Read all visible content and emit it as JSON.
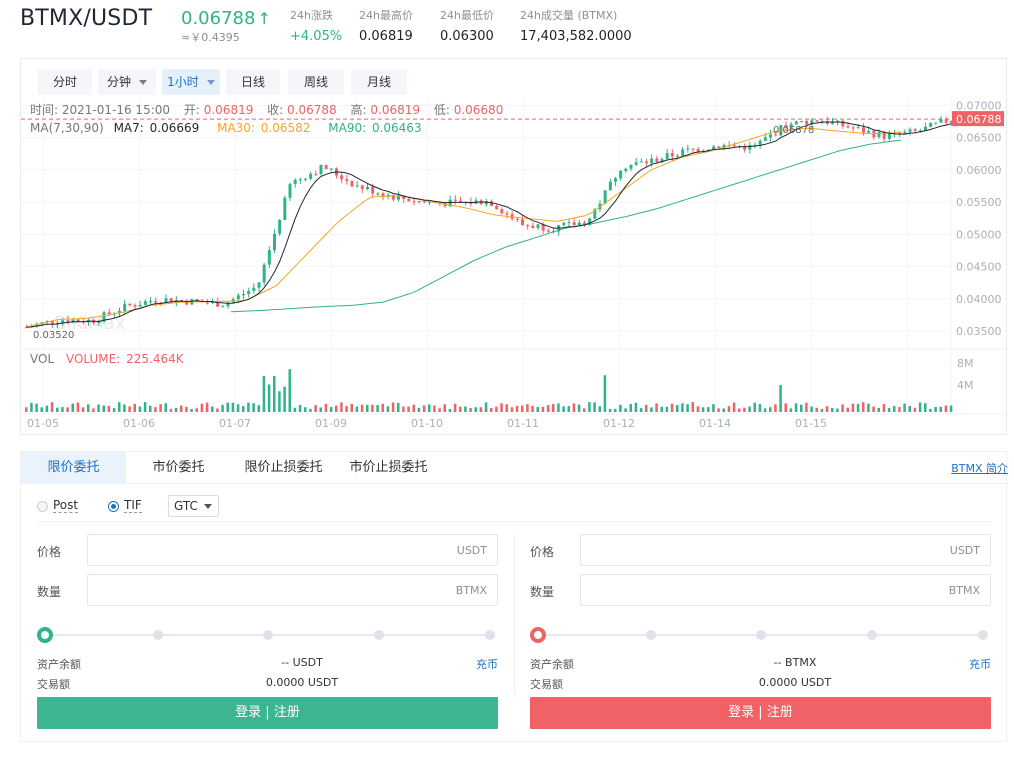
{
  "header": {
    "pair": "BTMX/USDT",
    "last_price": "0.06788",
    "arrow": "↑",
    "cny_price": "≈￥0.4395",
    "stats": [
      {
        "label": "24h涨跌",
        "value": "+4.05%"
      },
      {
        "label": "24h最高价",
        "value": "0.06819"
      },
      {
        "label": "24h最低价",
        "value": "0.06300"
      },
      {
        "label": "24h成交量 (BTMX)",
        "value": "17,403,582.0000"
      }
    ]
  },
  "chart": {
    "timeframes": [
      {
        "label": "分时"
      },
      {
        "label": "分钟",
        "dropdown": true
      },
      {
        "label": "1小时",
        "dropdown": true,
        "active": true
      },
      {
        "label": "日线"
      },
      {
        "label": "周线"
      },
      {
        "label": "月线"
      }
    ],
    "info": {
      "time_label": "时间:",
      "time": "2021-01-16 15:00",
      "open_label": "开:",
      "open": "0.06819",
      "close_label": "收:",
      "close": "0.06788",
      "high_label": "高:",
      "high": "0.06819",
      "low_label": "低:",
      "low": "0.06680"
    },
    "ma": {
      "label": "MA(7,30,90)",
      "ma7_label": "MA7:",
      "ma7": "0.06669",
      "ma30_label": "MA30:",
      "ma30": "0.06582",
      "ma90_label": "MA90:",
      "ma90": "0.06463"
    },
    "volume": {
      "label": "VOL",
      "value_label": "VOLUME:",
      "value": "225.464K"
    },
    "watermark": "BiKiMax",
    "max_marker": "0.06878",
    "min_marker": "0.03520",
    "current_price": "0.06788",
    "colors": {
      "up": "#2fb38a",
      "down": "#f06266",
      "ma7": "#1f2733",
      "ma30": "#f5a623",
      "ma90": "#2fb38a"
    }
  },
  "chart_data": {
    "type": "candlestick",
    "title": "",
    "price_axis_ticks": [
      "0.07000",
      "0.06500",
      "0.06000",
      "0.05500",
      "0.05000",
      "0.04500",
      "0.04000",
      "0.03500"
    ],
    "volume_axis_ticks": [
      "8M",
      "4M"
    ],
    "date_ticks": [
      "01-05",
      "01-06",
      "01-07",
      "01-09",
      "01-10",
      "01-11",
      "01-12",
      "01-14",
      "01-15"
    ],
    "ylim": [
      0.033,
      0.071
    ],
    "price_path": [
      [
        "01-05",
        0.0356
      ],
      [
        "01-06",
        0.0368
      ],
      [
        "01-06",
        0.0366
      ],
      [
        "01-07",
        0.0388
      ],
      [
        "01-07",
        0.04
      ],
      [
        "01-08",
        0.0396
      ],
      [
        "01-08",
        0.0392
      ],
      [
        "01-08",
        0.042
      ],
      [
        "01-08",
        0.058
      ],
      [
        "01-09",
        0.0605
      ],
      [
        "01-09",
        0.0575
      ],
      [
        "01-09",
        0.056
      ],
      [
        "01-10",
        0.055
      ],
      [
        "01-10",
        0.0548
      ],
      [
        "01-10",
        0.0552
      ],
      [
        "01-11",
        0.0515
      ],
      [
        "01-11",
        0.051
      ],
      [
        "01-11",
        0.052
      ],
      [
        "01-12",
        0.0605
      ],
      [
        "01-12",
        0.0615
      ],
      [
        "01-13",
        0.063
      ],
      [
        "01-13",
        0.0638
      ],
      [
        "01-14",
        0.0635
      ],
      [
        "01-14",
        0.067
      ],
      [
        "01-14",
        0.0678
      ],
      [
        "01-15",
        0.0665
      ],
      [
        "01-15",
        0.0652
      ],
      [
        "01-15",
        0.066
      ],
      [
        "01-16",
        0.06788
      ]
    ],
    "ma30_path": [
      0.0356,
      0.0368,
      0.037,
      0.0378,
      0.039,
      0.0395,
      0.0396,
      0.0397,
      0.042,
      0.047,
      0.052,
      0.0558,
      0.056,
      0.055,
      0.0542,
      0.053,
      0.0525,
      0.052,
      0.053,
      0.0565,
      0.06,
      0.062,
      0.063,
      0.0645,
      0.066,
      0.0665,
      0.066,
      0.0656,
      0.06582
    ],
    "ma90_path": [
      0.038,
      0.0382,
      0.0385,
      0.0388,
      0.039,
      0.0395,
      0.041,
      0.0435,
      0.046,
      0.048,
      0.0495,
      0.051,
      0.0518,
      0.0528,
      0.054,
      0.0555,
      0.057,
      0.0585,
      0.06,
      0.0615,
      0.063,
      0.064,
      0.06463
    ],
    "volume_peak_note": "tallest volume bars near 01-09 and 01-12"
  },
  "order": {
    "tabs": [
      "限价委托",
      "市价委托",
      "限价止损委托",
      "市价止损委托"
    ],
    "info_link": "BTMX 简介",
    "opt_post": "Post",
    "opt_tif": "TIF",
    "tif_select": "GTC",
    "buy": {
      "price_label": "价格",
      "price_unit": "USDT",
      "qty_label": "数量",
      "qty_unit": "BTMX",
      "balance_label": "资产余额",
      "balance_value": "-- USDT",
      "deposit": "充币",
      "amount_label": "交易额",
      "amount_value": "0.0000 USDT",
      "button": "登录 | 注册"
    },
    "sell": {
      "price_label": "价格",
      "price_unit": "USDT",
      "qty_label": "数量",
      "qty_unit": "BTMX",
      "balance_label": "资产余额",
      "balance_value": "-- BTMX",
      "deposit": "充币",
      "amount_label": "交易额",
      "amount_value": "0.0000 USDT",
      "button": "登录 | 注册"
    }
  }
}
